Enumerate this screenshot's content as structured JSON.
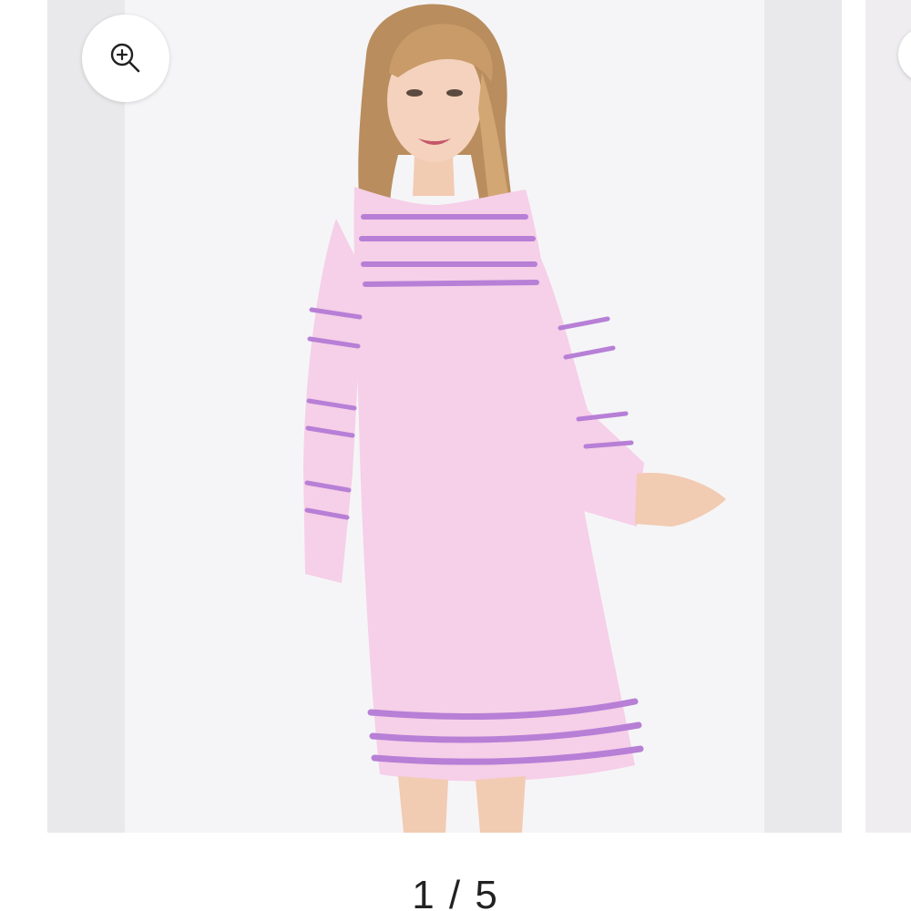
{
  "gallery": {
    "zoom_icon": "zoom-in-icon",
    "counter_text": "1 / 5",
    "current_index": 1,
    "total_images": 5
  },
  "colors": {
    "dress": "#f6cfe8",
    "embroidery": "#b77fd6",
    "background": "#f5f5f7"
  }
}
